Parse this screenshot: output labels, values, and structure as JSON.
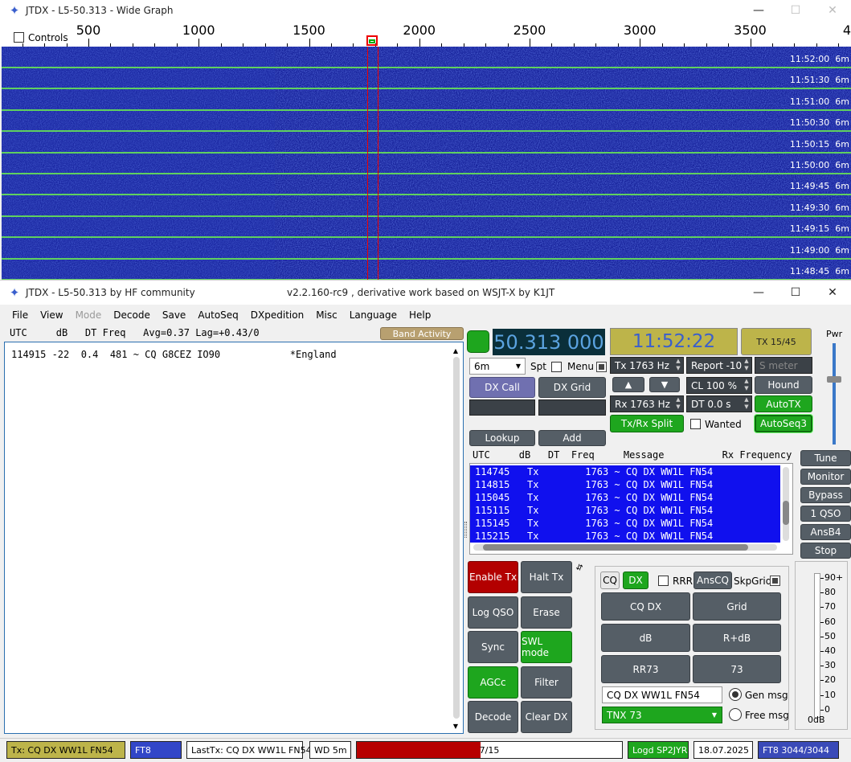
{
  "wide_graph": {
    "title": "JTDX - L5-50.313 - Wide Graph",
    "controls_label": "Controls",
    "scale": [
      "500",
      "1000",
      "1500",
      "2000",
      "2500",
      "3000",
      "3500",
      "4"
    ],
    "timestamps": [
      "11:52:00  6m",
      "11:51:30  6m",
      "11:51:00  6m",
      "11:50:30  6m",
      "11:50:15  6m",
      "11:50:00  6m",
      "11:49:45  6m",
      "11:49:30  6m",
      "11:49:15  6m",
      "11:49:00  6m",
      "11:48:45  6m"
    ]
  },
  "main": {
    "title_left": "JTDX - L5-50.313  by HF community",
    "title_center": "v2.2.160-rc9 , derivative work based on WSJT-X by K1JT",
    "menu": [
      "File",
      "View",
      "Mode",
      "Decode",
      "Save",
      "AutoSeq",
      "DXpedition",
      "Misc",
      "Language",
      "Help"
    ]
  },
  "band_activity": {
    "header": "UTC     dB   DT Freq   Avg=0.37 Lag=+0.43/0",
    "button": "Band Activity",
    "rows": [
      "114915 -22  0.4  481 ~ CQ G8CEZ IO90            *England"
    ]
  },
  "controls": {
    "frequency": "50.313 000",
    "clock": "11:52:22",
    "tx_period": "TX 15/45",
    "pwr_label": "Pwr",
    "band": "6m",
    "spt": "Spt",
    "menu_label": "Menu",
    "tx_hz": "Tx  1763  Hz",
    "rx_hz": "Rx  1763  Hz",
    "report": "Report -10",
    "cl": "CL  100 %",
    "dt": "DT 0.0 s",
    "smeter": "S meter",
    "hound": "Hound",
    "autotx": "AutoTX",
    "autoseq3": "AutoSeq3",
    "dx_call": "DX Call",
    "dx_grid": "DX Grid",
    "txrx_split": "Tx/Rx Split",
    "wanted": "Wanted",
    "lookup": "Lookup",
    "add": "Add",
    "up_arrow": "▲",
    "down_arrow": "▼"
  },
  "rx_list": {
    "header": "UTC     dB   DT  Freq     Message          Rx Frequency",
    "rows": [
      "114745   Tx        1763 ~ CQ DX WW1L FN54",
      "114815   Tx        1763 ~ CQ DX WW1L FN54",
      "115045   Tx        1763 ~ CQ DX WW1L FN54",
      "115115   Tx        1763 ~ CQ DX WW1L FN54",
      "115145   Tx        1763 ~ CQ DX WW1L FN54",
      "115215   Tx        1763 ~ CQ DX WW1L FN54"
    ]
  },
  "side_buttons": [
    "Tune",
    "Monitor",
    "Bypass",
    "1 QSO",
    "AnsB4",
    "Stop"
  ],
  "left_buttons": {
    "enable_tx": "Enable Tx",
    "halt_tx": "Halt Tx",
    "log_qso": "Log QSO",
    "erase": "Erase",
    "sync": "Sync",
    "swl": "SWL mode",
    "agcc": "AGCc",
    "filter": "Filter",
    "decode": "Decode",
    "clear_dx": "Clear DX"
  },
  "msg_panel": {
    "cq": "CQ",
    "dx": "DX",
    "rrr": "RRR",
    "anscq": "AnsCQ",
    "skpgrid": "SkpGrid",
    "cq_dx": "CQ DX",
    "grid": "Grid",
    "db": "dB",
    "rdb": "R+dB",
    "rr73": "RR73",
    "73": "73",
    "gen_text": "CQ DX WW1L FN54",
    "gen_msg": "Gen msg",
    "free_text": "TNX 73",
    "free_msg": "Free msg"
  },
  "meter": {
    "labels": [
      "90+",
      "80",
      "70",
      "60",
      "50",
      "40",
      "30",
      "20",
      "10",
      "0"
    ],
    "value_label": "0dB"
  },
  "status": {
    "tx": "Tx: CQ DX WW1L FN54",
    "mode": "FT8",
    "last_tx": "LastTx: CQ DX WW1L FN54",
    "wd": "WD 5m",
    "progress_text": "7/15",
    "progress_fraction": 0.4667,
    "logd": "Logd SP2JYR",
    "date": "18.07.2025",
    "decodes": "FT8  3044/3044"
  }
}
